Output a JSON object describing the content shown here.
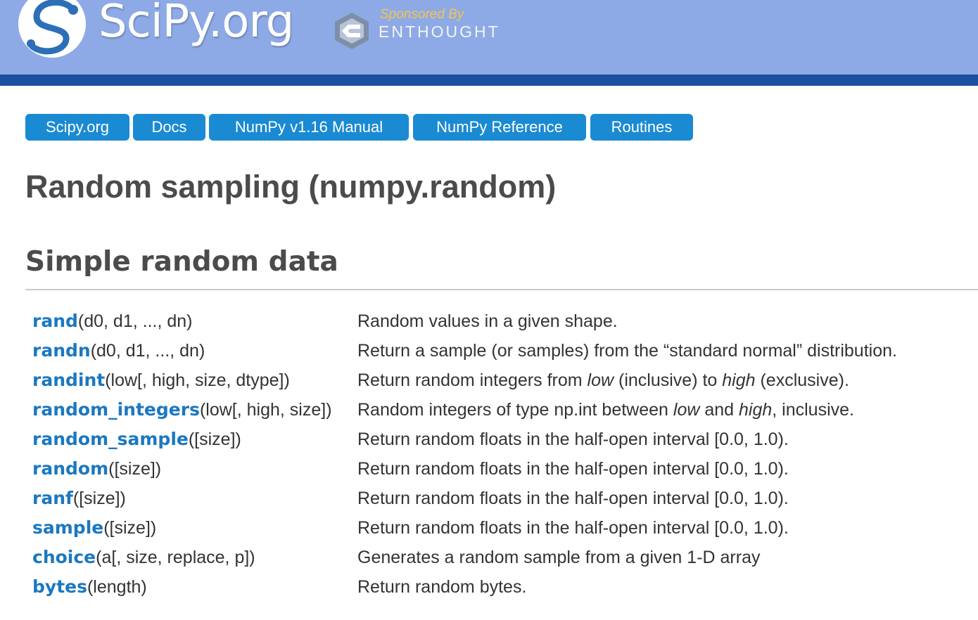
{
  "header": {
    "logo_text": "SciPy.org",
    "sponsor_by": "Sponsored By",
    "sponsor_name": "ENTHOUGHT",
    "colors": {
      "banner": "#8eaae6",
      "stripe": "#1b4f9f"
    }
  },
  "breadcrumbs": [
    {
      "label": "Scipy.org"
    },
    {
      "label": "Docs"
    },
    {
      "label": "NumPy v1.16 Manual"
    },
    {
      "label": "NumPy Reference"
    },
    {
      "label": "Routines"
    }
  ],
  "page": {
    "title": "Random sampling (numpy.random)",
    "section_title": "Simple random data"
  },
  "functions": [
    {
      "name": "rand",
      "params": "(d0, d1, ..., dn)",
      "desc": [
        "Random values in a given shape."
      ]
    },
    {
      "name": "randn",
      "params": "(d0, d1, ..., dn)",
      "desc": [
        "Return a sample (or samples) from the “standard normal” distribution."
      ]
    },
    {
      "name": "randint",
      "params": "(low[, high, size, dtype])",
      "desc": [
        "Return random integers from ",
        "low",
        " (inclusive) to ",
        "high",
        " (exclusive)."
      ]
    },
    {
      "name": "random_integers",
      "params": "(low[, high, size])",
      "desc": [
        "Random integers of type np.int between ",
        "low",
        " and ",
        "high",
        ", inclusive."
      ]
    },
    {
      "name": "random_sample",
      "params": "([size])",
      "desc": [
        "Return random floats in the half-open interval [0.0, 1.0)."
      ]
    },
    {
      "name": "random",
      "params": "([size])",
      "desc": [
        "Return random floats in the half-open interval [0.0, 1.0)."
      ]
    },
    {
      "name": "ranf",
      "params": "([size])",
      "desc": [
        "Return random floats in the half-open interval [0.0, 1.0)."
      ]
    },
    {
      "name": "sample",
      "params": "([size])",
      "desc": [
        "Return random floats in the half-open interval [0.0, 1.0)."
      ]
    },
    {
      "name": "choice",
      "params": "(a[, size, replace, p])",
      "desc": [
        "Generates a random sample from a given 1-D array"
      ]
    },
    {
      "name": "bytes",
      "params": "(length)",
      "desc": [
        "Return random bytes."
      ]
    }
  ],
  "colors": {
    "accent": "#1a8ad2",
    "link": "#1b78c0"
  }
}
